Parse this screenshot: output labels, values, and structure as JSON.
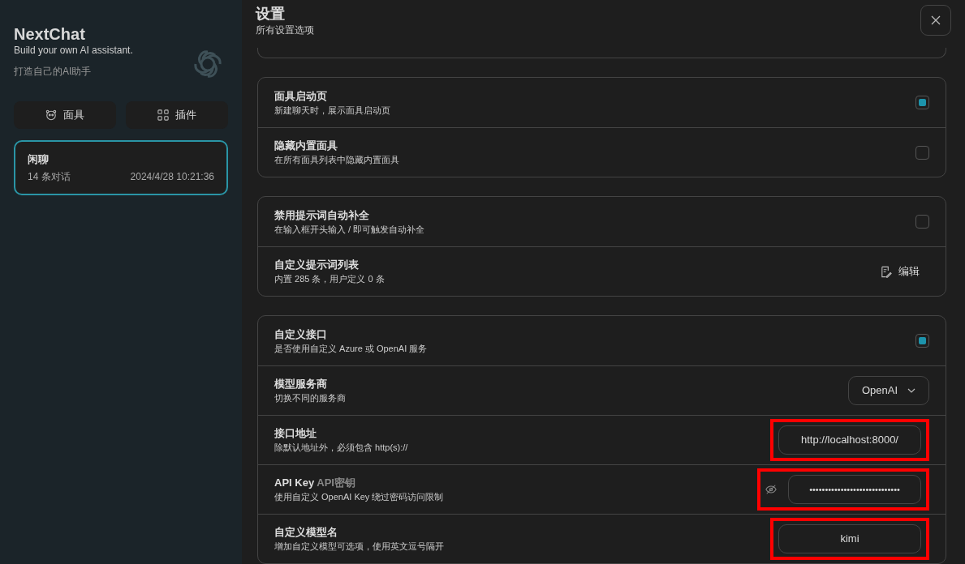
{
  "sidebar": {
    "title": "NextChat",
    "subtitle": "Build your own AI assistant.",
    "note": "打造自己的AI助手",
    "buttons": [
      {
        "kind": "mask",
        "label": "面具"
      },
      {
        "kind": "plugin",
        "label": "插件"
      }
    ],
    "chats": [
      {
        "title": "闲聊",
        "count": "14 条对话",
        "time": "2024/4/28 10:21:36",
        "selected": true
      }
    ]
  },
  "header": {
    "title": "设置",
    "subtitle": "所有设置选项"
  },
  "groups": [
    {
      "rows": [
        {
          "kind": "checkbox",
          "title": "面具启动页",
          "desc": "新建聊天时，展示面具启动页",
          "checked": true,
          "highlighted": false
        },
        {
          "kind": "checkbox",
          "title": "隐藏内置面具",
          "desc": "在所有面具列表中隐藏内置面具",
          "checked": false,
          "highlighted": false
        }
      ]
    },
    {
      "rows": [
        {
          "kind": "checkbox",
          "title": "禁用提示词自动补全",
          "desc": "在输入框开头输入 / 即可触发自动补全",
          "checked": false,
          "highlighted": false
        },
        {
          "kind": "action",
          "title": "自定义提示词列表",
          "desc": "内置 285 条，用户定义 0 条",
          "action": "编辑",
          "highlighted": false
        }
      ]
    },
    {
      "rows": [
        {
          "kind": "checkbox",
          "title": "自定义接口",
          "desc": "是否使用自定义 Azure 或 OpenAI 服务",
          "checked": true,
          "highlighted": false
        },
        {
          "kind": "select",
          "title": "模型服务商",
          "desc": "切换不同的服务商",
          "value": "OpenAI",
          "highlighted": false
        },
        {
          "kind": "input",
          "title": "接口地址",
          "desc": "除默认地址外，必须包含 http(s)://",
          "value": "http://localhost:8000/",
          "highlighted": true
        },
        {
          "kind": "password",
          "title": "API Key",
          "title_extra": "API密钥",
          "desc": "使用自定义 OpenAI Key 绕过密码访问限制",
          "value": "•••••••••••••••••••••••••••••",
          "highlighted": true
        },
        {
          "kind": "input",
          "title": "自定义模型名",
          "desc": "增加自定义模型可选项，使用英文逗号隔开",
          "value": "kimi",
          "highlighted": true
        }
      ]
    }
  ]
}
